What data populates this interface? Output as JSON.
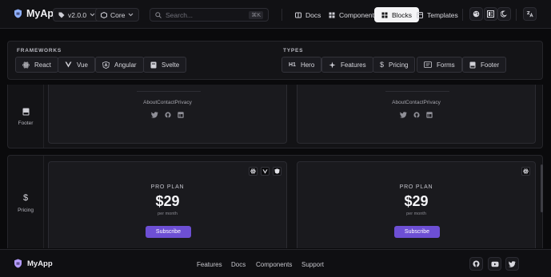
{
  "header": {
    "app_name": "MyApp",
    "version": "v2.0.0",
    "core": "Core",
    "search_placeholder": "Search...",
    "search_shortcut": "⌘K",
    "nav": [
      {
        "label": "Docs",
        "icon": "book-icon"
      },
      {
        "label": "Components",
        "icon": "grid-icon"
      },
      {
        "label": "Blocks",
        "icon": "blocks-icon",
        "active": true
      },
      {
        "label": "Templates",
        "icon": "template-icon"
      }
    ]
  },
  "filters": {
    "frameworks_label": "FRAMEWORKS",
    "types_label": "TYPES",
    "frameworks": [
      "React",
      "Vue",
      "Angular",
      "Svelte"
    ],
    "types": [
      "Hero",
      "Features",
      "Pricing",
      "Forms",
      "Footer"
    ]
  },
  "footer_section": {
    "label": "Footer",
    "card_left_links": "AboutContactPrivacy",
    "card_right_links": "AboutContactPrivacy"
  },
  "pricing_section": {
    "label": "Pricing",
    "left": {
      "plan": "PRO PLAN",
      "price": "$29",
      "period": "per month",
      "button": "Subscribe"
    },
    "right": {
      "plan": "PRO PLAN",
      "price": "$29",
      "period": "per month",
      "button": "Subscribe"
    }
  },
  "footer": {
    "app_name": "MyApp",
    "links": [
      "Features",
      "Docs",
      "Components",
      "Support"
    ]
  },
  "colors": {
    "accent": "#6d4fd4",
    "background": "#0a0a0c",
    "logo": "#9db8ff"
  }
}
